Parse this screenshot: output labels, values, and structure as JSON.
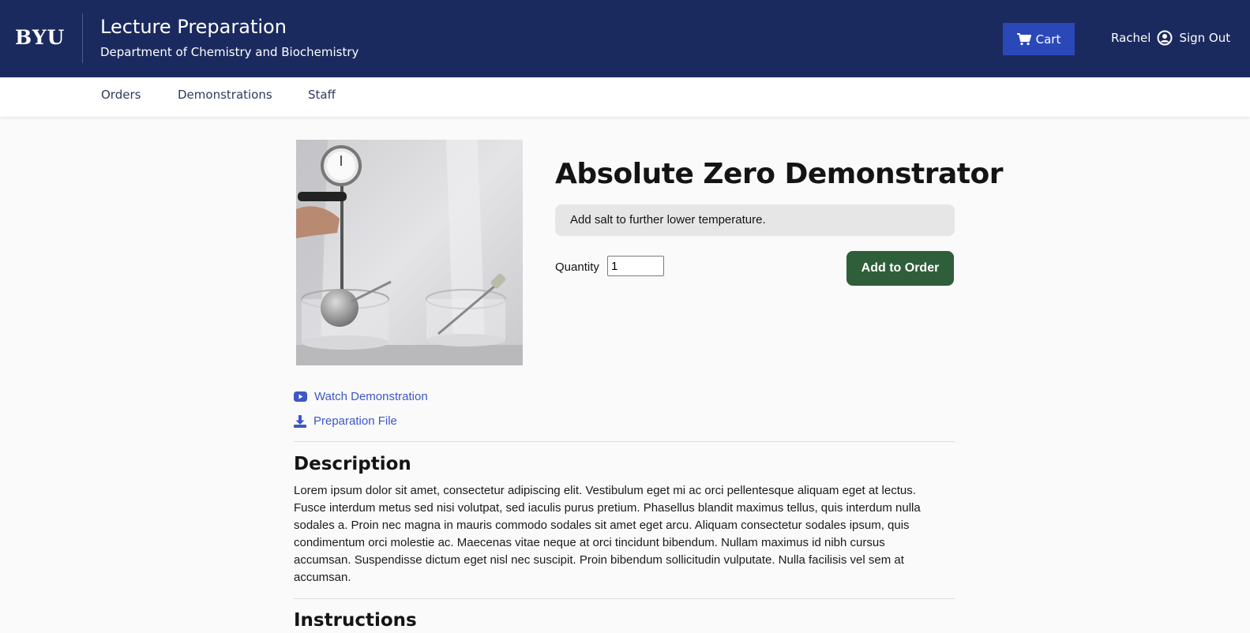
{
  "header": {
    "logo": "BYU",
    "title": "Lecture Preparation",
    "subtitle": "Department of Chemistry and Biochemistry",
    "cart_label": "Cart",
    "user_name": "Rachel",
    "sign_out_label": "Sign Out"
  },
  "nav": {
    "items": [
      {
        "label": "Orders"
      },
      {
        "label": "Demonstrations"
      },
      {
        "label": "Staff"
      }
    ]
  },
  "product": {
    "title": "Absolute Zero Demonstrator",
    "note": "Add salt to further lower temperature.",
    "quantity_label": "Quantity",
    "quantity_value": "1",
    "add_button_label": "Add to Order",
    "image_alt": "Absolute zero apparatus with gauge and thermometer in water baths"
  },
  "links": {
    "watch": "Watch Demonstration",
    "prep_file": "Preparation File"
  },
  "description": {
    "heading": "Description",
    "text": "Lorem ipsum dolor sit amet, consectetur adipiscing elit. Vestibulum eget mi ac orci pellentesque aliquam eget at lectus. Fusce interdum metus sed nisi volutpat, sed iaculis purus pretium. Phasellus blandit maximus tellus, quis interdum nulla sodales a. Proin nec magna in mauris commodo sodales sit amet eget arcu. Aliquam consectetur sodales ipsum, quis condimentum orci molestie ac. Maecenas vitae neque at orci tincidunt bibendum. Nullam maximus id nibh cursus accumsan. Suspendisse dictum eget nisl nec suscipit. Proin bibendum sollicitudin vulputate. Nulla facilisis vel sem at accumsan."
  },
  "instructions": {
    "heading": "Instructions"
  },
  "icons": {
    "cart": "cart-icon",
    "user": "user-circle-icon",
    "video": "youtube-icon",
    "download": "download-icon"
  },
  "colors": {
    "header_bg": "#1b2a5e",
    "cart_button": "#2b48b9",
    "add_button": "#2f5e3a",
    "link": "#3d57c7"
  }
}
